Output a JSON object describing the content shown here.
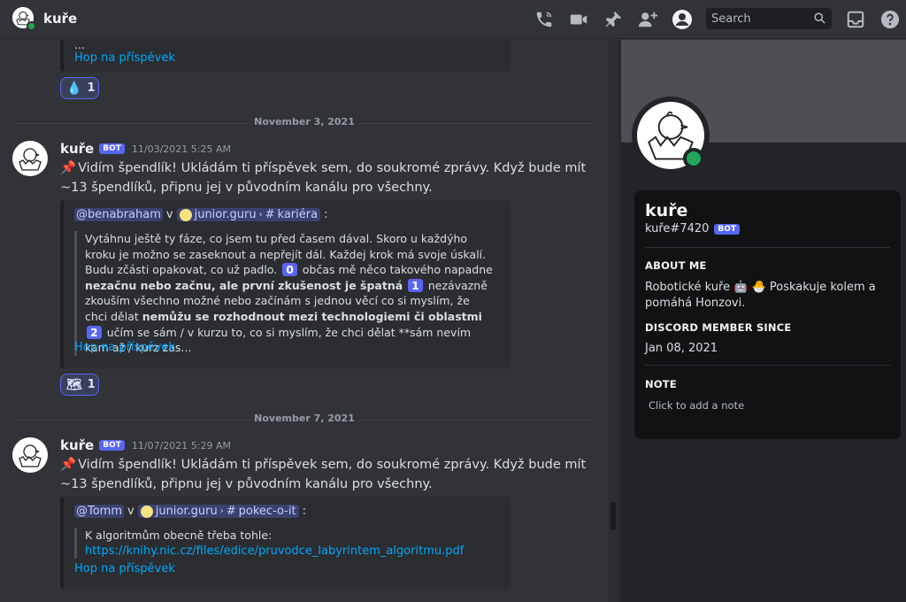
{
  "header": {
    "title": "kuře",
    "search_placeholder": "Search"
  },
  "messages": [
    {
      "author": "kuře",
      "bot_tag": "BOT",
      "time": "11/03/2021 5:25 AM",
      "text": "Vidím špendlík! Ukládám ti příspěvek sem, do soukromé zprávy. Když bude mít ~13 špendlíků, připnu jej v původním kanálu pro všechny.",
      "embed": {
        "mention": "@benabraham",
        "in_word": "v",
        "server": "junior.guru",
        "channel": "kariéra",
        "colon": ":",
        "quote": {
          "p1": "Vytáhnu ještě ty fáze, co jsem tu před časem dával. Skoro u každýho kroku je možno se zaseknout a nepřejít dál. Každej krok má svoje úskalí. Budu zčásti opakovat, co už padlo.",
          "n0": "0",
          "p2": "občas mě něco takového napadne",
          "b1": "nezačnu nebo začnu, ale první zkušenost je špatná",
          "n1": "1",
          "p3": "nezávazně zkouším všechno možné nebo začínám s jednou věcí co si myslím, že chci dělat",
          "b2": "nemůžu se rozhodnout mezi technologiemi či oblastmi",
          "n2": "2",
          "p4": "učím se sám / v kurzu to, co si myslím, že chci dělat **sám nevím kam až / kurz zas..."
        },
        "jump": "Hop na příspěvek"
      },
      "reaction": {
        "count": "1"
      }
    },
    {
      "author": "kuře",
      "bot_tag": "BOT",
      "time": "11/07/2021 5:29 AM",
      "text": "Vidím špendlík! Ukládám ti příspěvek sem, do soukromé zprávy. Když bude mít ~13 špendlíků, připnu jej v původním kanálu pro všechny.",
      "embed": {
        "mention": "@Tomm",
        "in_word": "v",
        "server": "junior.guru",
        "channel": "pokec-o-it",
        "colon": ":",
        "quote": {
          "p1": "K algoritmům obecně třeba tohle:",
          "link": "https://knihy.nic.cz/files/edice/pruvodce_labyrintem_algoritmu.pdf"
        },
        "jump": "Hop na příspěvek"
      }
    }
  ],
  "top_partial": {
    "text": "...",
    "jump": "Hop na příspěvek",
    "reaction_count": "1"
  },
  "dividers": [
    "November 3, 2021",
    "November 7, 2021"
  ],
  "profile": {
    "name": "kuře",
    "tag": "kuře#7420",
    "bot_tag": "BOT",
    "about_title": "ABOUT ME",
    "about_text": "Robotické kuře",
    "about_text2": "Poskakuje kolem a pomáhá Honzovi.",
    "since_title": "DISCORD MEMBER SINCE",
    "since_date": "Jan 08, 2021",
    "note_title": "NOTE",
    "note_placeholder": "Click to add a note"
  },
  "colors": {
    "accent": "#5865f2",
    "online": "#23a55a",
    "link": "#00a8fc"
  }
}
